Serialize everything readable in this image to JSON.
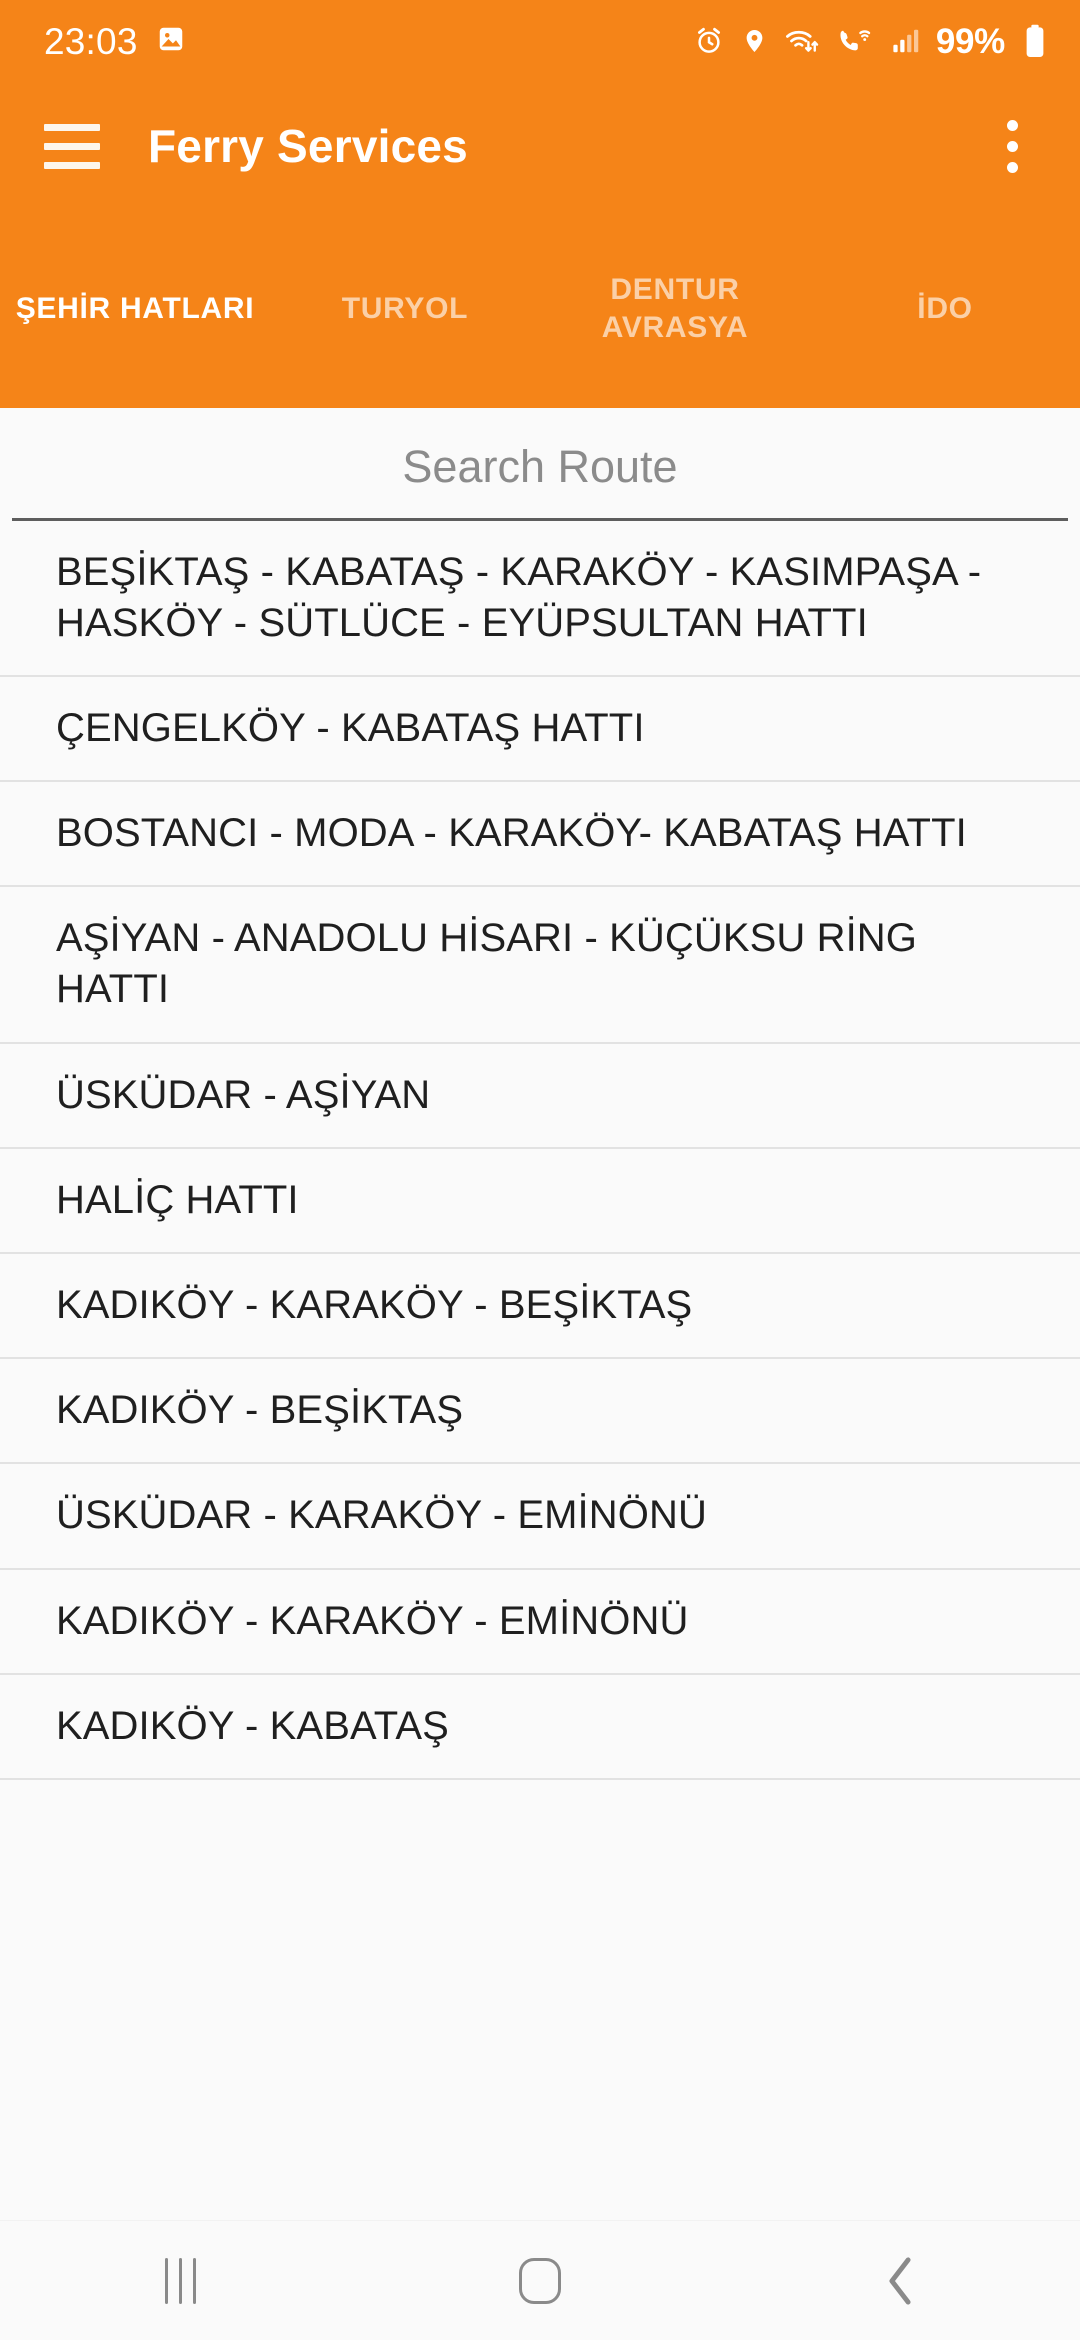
{
  "status_bar": {
    "time": "23:03",
    "battery_percent": "99%",
    "icons": [
      "gallery-image-icon",
      "alarm-icon",
      "location-icon",
      "wifi-data-icon",
      "wifi-calling-icon",
      "cellular-signal-icon",
      "battery-icon"
    ]
  },
  "app_bar": {
    "title": "Ferry Services",
    "menu_icon": "hamburger-menu-icon",
    "overflow_icon": "overflow-menu-icon"
  },
  "tabs": [
    {
      "label": "ŞEHİR HATLARI",
      "active": true
    },
    {
      "label": "TURYOL",
      "active": false
    },
    {
      "label": "DENTUR AVRASYA",
      "active": false
    },
    {
      "label": "İDO",
      "active": false
    }
  ],
  "search": {
    "placeholder": "Search Route",
    "value": ""
  },
  "routes": [
    "BEŞİKTAŞ - KABATAŞ - KARAKÖY - KASIMPAŞA - HASKÖY - SÜTLÜCE - EYÜPSULTAN HATTI",
    "ÇENGELKÖY - KABATAŞ HATTI",
    "BOSTANCI - MODA - KARAKÖY- KABATAŞ HATTI",
    "AŞİYAN - ANADOLU HİSARI - KÜÇÜKSU RİNG HATTI",
    "ÜSKÜDAR - AŞİYAN",
    "HALİÇ HATTI",
    "KADIKÖY - KARAKÖY - BEŞİKTAŞ",
    "KADIKÖY - BEŞİKTAŞ",
    "ÜSKÜDAR - KARAKÖY - EMİNÖNÜ",
    "KADIKÖY - KARAKÖY - EMİNÖNÜ",
    "KADIKÖY - KABATAŞ"
  ],
  "nav_bar": {
    "recents_icon": "recents-icon",
    "home_icon": "home-icon",
    "back_icon": "back-icon"
  },
  "colors": {
    "brand_orange": "#F58418",
    "page_background": "#FAFAFA",
    "text_primary": "#1F1F1F",
    "divider": "#E2E2E2"
  }
}
